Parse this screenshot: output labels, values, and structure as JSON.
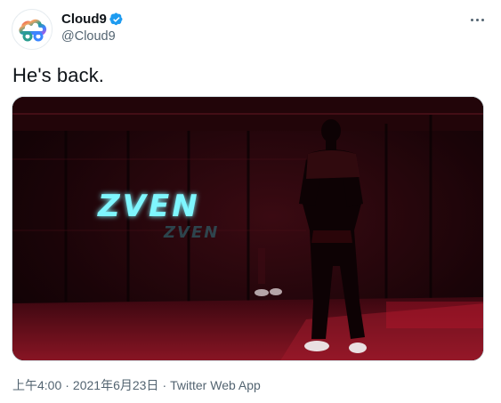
{
  "author": {
    "display_name": "Cloud9",
    "handle": "@Cloud9",
    "verified": true,
    "avatar_icon": "cloud9-logo-icon"
  },
  "tweet": {
    "text": "He's back.",
    "media": {
      "type": "photo",
      "sign_text": "ZVEN"
    }
  },
  "meta": {
    "time": "上午4:00",
    "separator": "·",
    "date": "2021年6月23日",
    "source": "Twitter Web App"
  },
  "colors": {
    "verified_blue": "#1d9bf0",
    "secondary_text": "#536471",
    "neon_cyan": "#5ff2ff",
    "red_light": "#d3122e"
  }
}
